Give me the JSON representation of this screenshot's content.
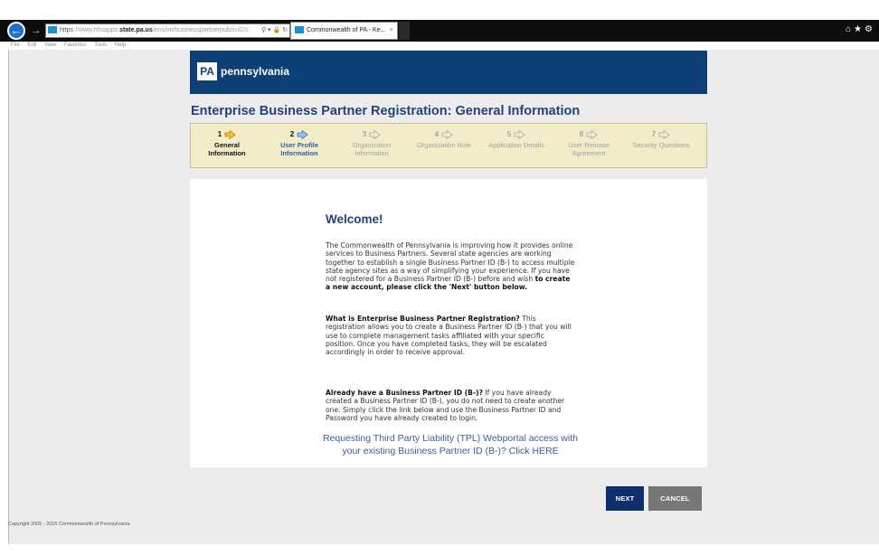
{
  "browser": {
    "address": {
      "protocol": "https",
      "host_prefix": "://www.hhsapps.",
      "host": "state.pa.us",
      "path": "/ens/im/businesspartnerpub/cul2/c"
    },
    "tab_title": "Commonwealth of PA - Ke...",
    "tab_close": "×",
    "menu_items": [
      "File",
      "Edit",
      "View",
      "Favorites",
      "Tools",
      "Help"
    ]
  },
  "header": {
    "logo_mark": "PA",
    "logo_text": "pennsylvania"
  },
  "page_title": "Enterprise Business Partner Registration: General Information",
  "steps": [
    {
      "num": "1",
      "label_line1": "General",
      "label_line2": "Information",
      "state": "active"
    },
    {
      "num": "2",
      "label_line1": "User Profile",
      "label_line2": "Information",
      "state": "done"
    },
    {
      "num": "3",
      "label_line1": "Organization",
      "label_line2": "Information",
      "state": "pending"
    },
    {
      "num": "4",
      "label_line1": "Organization Role",
      "label_line2": "",
      "state": "pending"
    },
    {
      "num": "5",
      "label_line1": "Application Details",
      "label_line2": "",
      "state": "pending"
    },
    {
      "num": "6",
      "label_line1": "User Release",
      "label_line2": "Agreement",
      "state": "pending"
    },
    {
      "num": "7",
      "label_line1": "Security Questions",
      "label_line2": "",
      "state": "pending"
    }
  ],
  "content": {
    "welcome": "Welcome!",
    "p1_text": "The Commonwealth of Pennsylvania is improving how it provides online services to Business Partners. Several state agencies are working together to establish a single Business Partner ID (B-) to access multiple state agency sites as a way of simplifying your experience. If you have not registered for a Business Partner ID (B-) before and wish ",
    "p1_bold": "to create a new account, please click the 'Next' button below.",
    "p2_bold": "What is Enterprise Business Partner Registration?",
    "p2_text": " This registration allows you to create a Business Partner ID (B-) that you will use to complete management tasks affiliated with your specific position. Once you have completed tasks, they will be escalated accordingly in order to receive approval.",
    "p3_bold": "Already have a Business Partner ID (B-)?",
    "p3_text": " If you have already created a Business Partner ID (B-), you do not need to create another one. Simply click the link below and use the Business Partner ID and Password you have already created to login.",
    "tpl_link": "Requesting Third Party Liability (TPL) Webportal access with your existing Business Partner ID (B-)? Click HERE"
  },
  "buttons": {
    "next": "NEXT",
    "cancel": "CANCEL"
  },
  "footer": "Copyright 2005 - 2015 Commonwealth of Pennsylvania",
  "colors": {
    "brand_navy": "#0e3f76",
    "title_blue": "#23437a",
    "step_bg": "#f2ecc9",
    "cancel_gray": "#777777"
  }
}
